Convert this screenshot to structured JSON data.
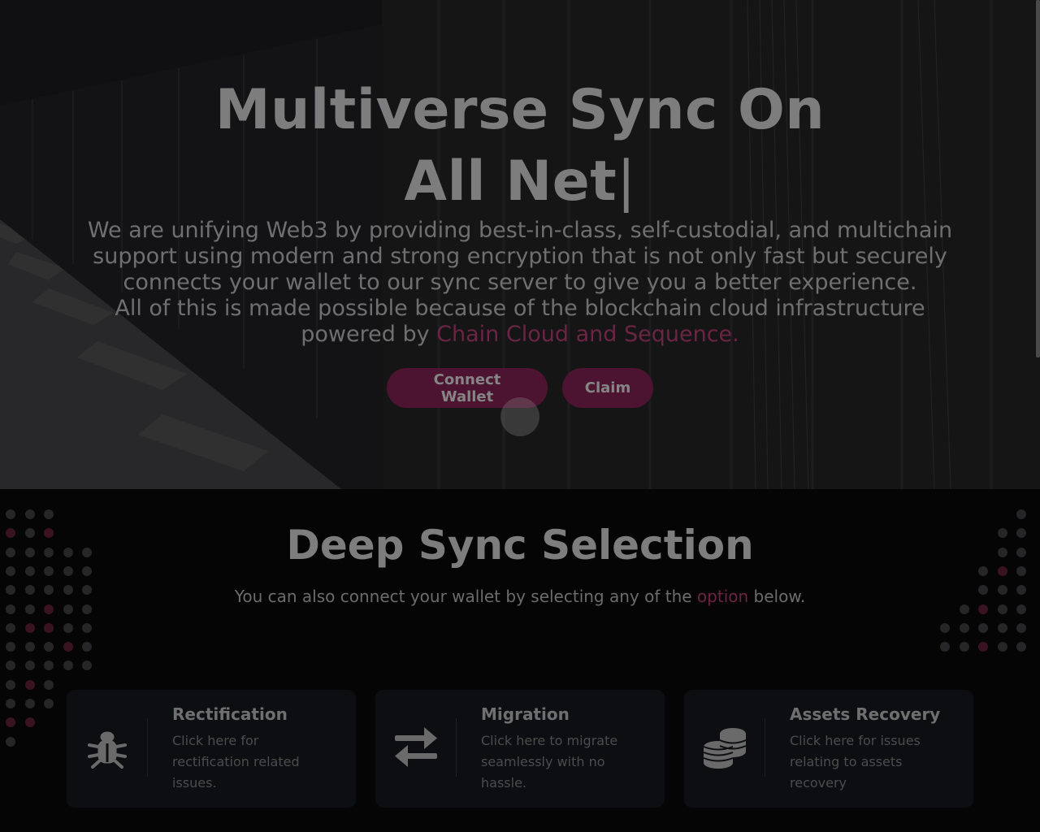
{
  "hero": {
    "title_line1": "Multiverse Sync On",
    "title_line2": "All Net",
    "cursor": "|",
    "desc_main": "We are unifying Web3 by providing best-in-class, self-custodial, and multichain support using modern and strong encryption that is not only fast but securely connects your wallet to our sync server to give you a better experience.",
    "desc_line2": "All of this is made possible because of the blockchain cloud infrastructure powered by",
    "desc_link": "Chain Cloud and Sequence.",
    "buttons": {
      "connect": "Connect Wallet",
      "claim": "Claim"
    }
  },
  "section": {
    "title": "Deep Sync Selection",
    "sub_before": "You can also connect your wallet by selecting any of the",
    "sub_link": "option",
    "sub_after": "below."
  },
  "cards": [
    {
      "icon": "bug-icon",
      "title": "Rectification",
      "desc": "Click here for rectification related issues."
    },
    {
      "icon": "arrows-exchange-icon",
      "title": "Migration",
      "desc": "Click here to migrate seamlessly with no hassle."
    },
    {
      "icon": "coins-icon",
      "title": "Assets Recovery",
      "desc": "Click here for issues relating to assets recovery"
    }
  ],
  "colors": {
    "accent": "#6b2443",
    "button_bg": "#4c1430",
    "card_bg": "#0d0e11",
    "page_bg": "#050506"
  }
}
